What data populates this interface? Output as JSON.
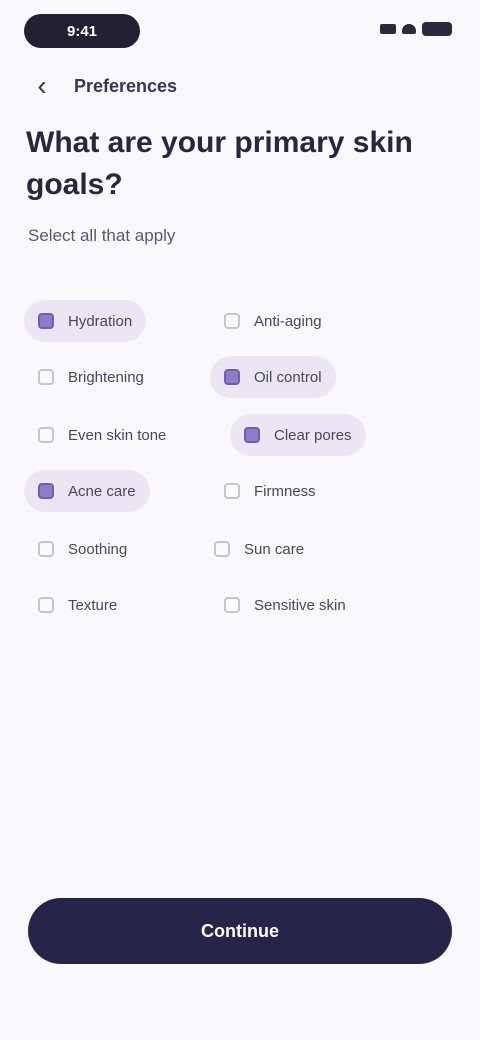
{
  "status_bar": {
    "time": "9:41"
  },
  "header": {
    "title": "Preferences"
  },
  "question": {
    "title": "What are your primary skin goals?",
    "subtitle": "Select all that apply"
  },
  "options": [
    {
      "label": "Hydration",
      "selected": true
    },
    {
      "label": "Anti-aging",
      "selected": false
    },
    {
      "label": "Brightening",
      "selected": false
    },
    {
      "label": "Oil control",
      "selected": true
    },
    {
      "label": "Even skin tone",
      "selected": false
    },
    {
      "label": "Clear pores",
      "selected": true
    },
    {
      "label": "Acne care",
      "selected": true
    },
    {
      "label": "Firmness",
      "selected": false
    },
    {
      "label": "Soothing",
      "selected": false
    },
    {
      "label": "Sun care",
      "selected": false
    },
    {
      "label": "Texture",
      "selected": false
    },
    {
      "label": "Sensitive skin",
      "selected": false
    }
  ],
  "footer": {
    "continue_label": "Continue"
  },
  "colors": {
    "primary": "#272449",
    "accent": "#8e7cc8",
    "background": "#fbf8fd",
    "selected_bg": "#ece6f4"
  }
}
